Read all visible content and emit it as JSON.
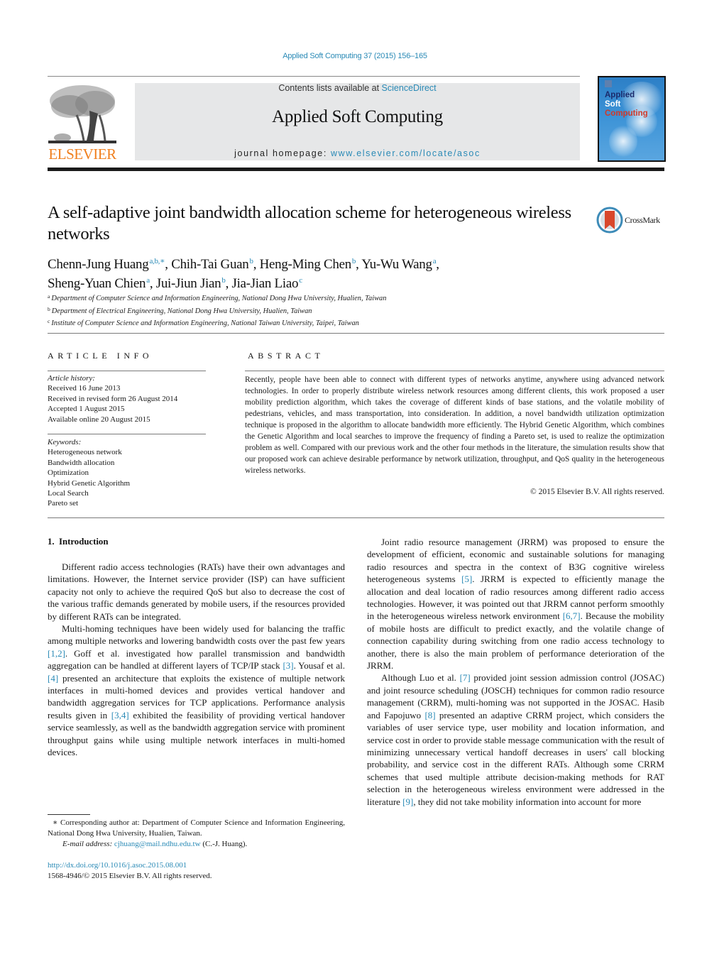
{
  "header": {
    "journal_ref": "Applied Soft Computing 37 (2015) 156–165",
    "contents_prefix": "Contents lists available at ",
    "contents_link": "ScienceDirect",
    "journal_title": "Applied Soft Computing",
    "homepage_prefix": "journal homepage: ",
    "homepage_link": "www.elsevier.com/locate/asoc",
    "publisher_logo": "ELSEVIER",
    "cover": {
      "line1": "Applied",
      "line2": "Soft",
      "line3": "Computing"
    },
    "colors": {
      "link": "#2a8ab6",
      "elsevier_orange": "#f07f1d",
      "masthead_bg": "#e6e7e8"
    }
  },
  "article": {
    "title": "A self-adaptive joint bandwidth allocation scheme for heterogeneous wireless networks",
    "crossmark_label": "CrossMark",
    "authors": [
      {
        "name": "Chenn-Jung Huang",
        "sup": "a,b,∗",
        "sep": ", "
      },
      {
        "name": "Chih-Tai Guan",
        "sup": "b",
        "sep": ", "
      },
      {
        "name": "Heng-Ming Chen",
        "sup": "b",
        "sep": ", "
      },
      {
        "name": "Yu-Wu Wang",
        "sup": "a",
        "sep": ","
      },
      {
        "name": "Sheng-Yuan Chien",
        "sup": "a",
        "sep": ", "
      },
      {
        "name": "Jui-Jiun Jian",
        "sup": "b",
        "sep": ", "
      },
      {
        "name": "Jia-Jian Liao",
        "sup": "c",
        "sep": ""
      }
    ],
    "affiliations": [
      {
        "key": "a",
        "text": "Department of Computer Science and Information Engineering, National Dong Hwa University, Hualien, Taiwan"
      },
      {
        "key": "b",
        "text": "Department of Electrical Engineering, National Dong Hwa University, Hualien, Taiwan"
      },
      {
        "key": "c",
        "text": "Institute of Computer Science and Information Engineering, National Taiwan University, Taipei, Taiwan"
      }
    ]
  },
  "article_info": {
    "heading": "ARTICLE INFO",
    "history_label": "Article history:",
    "history": [
      "Received 16 June 2013",
      "Received in revised form 26 August 2014",
      "Accepted 1 August 2015",
      "Available online 20 August 2015"
    ],
    "keywords_label": "Keywords:",
    "keywords": [
      "Heterogeneous network",
      "Bandwidth allocation",
      "Optimization",
      "Hybrid Genetic Algorithm",
      "Local Search",
      "Pareto set"
    ]
  },
  "abstract": {
    "heading": "ABSTRACT",
    "text": "Recently, people have been able to connect with different types of networks anytime, anywhere using advanced network technologies. In order to properly distribute wireless network resources among different clients, this work proposed a user mobility prediction algorithm, which takes the coverage of different kinds of base stations, and the volatile mobility of pedestrians, vehicles, and mass transportation, into consideration. In addition, a novel bandwidth utilization optimization technique is proposed in the algorithm to allocate bandwidth more efficiently. The Hybrid Genetic Algorithm, which combines the Genetic Algorithm and local searches to improve the frequency of finding a Pareto set, is used to realize the optimization problem as well. Compared with our previous work and the other four methods in the literature, the simulation results show that our proposed work can achieve desirable performance by network utilization, throughput, and QoS quality in the heterogeneous wireless networks.",
    "copyright": "© 2015 Elsevier B.V. All rights reserved."
  },
  "body": {
    "section_heading": "1.  Introduction",
    "left_paragraphs": [
      [
        {
          "t": "Different radio access technologies (RATs) have their own advantages and limitations. However, the Internet service provider (ISP) can have sufficient capacity not only to achieve the required QoS but also to decrease the cost of the various traffic demands generated by mobile users, if the resources provided by different RATs can be integrated."
        }
      ],
      [
        {
          "t": "Multi-homing techniques have been widely used for balancing the traffic among multiple networks and lowering bandwidth costs over the past few years "
        },
        {
          "ref": "[1,2]"
        },
        {
          "t": ". Goff et al. investigated how parallel transmission and bandwidth aggregation can be handled at different layers of TCP/IP stack "
        },
        {
          "ref": "[3]"
        },
        {
          "t": ". Yousaf et al. "
        },
        {
          "ref": "[4]"
        },
        {
          "t": " presented an architecture that exploits the existence of multiple network interfaces in multi-homed devices and provides vertical handover and bandwidth aggregation services for TCP applications. Performance analysis results given in "
        },
        {
          "ref": "[3,4]"
        },
        {
          "t": " exhibited the feasibility of providing vertical handover service seamlessly, as well as the bandwidth aggregation service with prominent throughput gains while using multiple network interfaces in multi-homed devices."
        }
      ]
    ],
    "right_paragraphs": [
      [
        {
          "t": "Joint radio resource management (JRRM) was proposed to ensure the development of efficient, economic and sustainable solutions for managing radio resources and spectra in the context of B3G cognitive wireless heterogeneous systems "
        },
        {
          "ref": "[5]"
        },
        {
          "t": ". JRRM is expected to efficiently manage the allocation and deal location of radio resources among different radio access technologies. However, it was pointed out that JRRM cannot perform smoothly in the heterogeneous wireless network environment "
        },
        {
          "ref": "[6,7]"
        },
        {
          "t": ". Because the mobility of mobile hosts are difficult to predict exactly, and the volatile change of connection capability during switching from one radio access technology to another, there is also the main problem of performance deterioration of the JRRM."
        }
      ],
      [
        {
          "t": "Although Luo et al. "
        },
        {
          "ref": "[7]"
        },
        {
          "t": " provided joint session admission control (JOSAC) and joint resource scheduling (JOSCH) techniques for common radio resource management (CRRM), multi-homing was not supported in the JOSAC. Hasib and Fapojuwo "
        },
        {
          "ref": "[8]"
        },
        {
          "t": " presented an adaptive CRRM project, which considers the variables of user service type, user mobility and location information, and service cost in order to provide stable message communication with the result of minimizing unnecessary vertical handoff decreases in users' call blocking probability, and service cost in the different RATs. Although some CRRM schemes that used multiple attribute decision-making methods for RAT selection in the heterogeneous wireless environment were addressed in the literature "
        },
        {
          "ref": "[9]"
        },
        {
          "t": ", they did not take mobility information into account for more"
        }
      ]
    ]
  },
  "footnote": {
    "corresponding": "∗ Corresponding author at: Department of Computer Science and Information Engineering, National Dong Hwa University, Hualien, Taiwan.",
    "email_label": "E-mail address: ",
    "email": "cjhuang@mail.ndhu.edu.tw",
    "email_suffix": " (C.-J. Huang).",
    "doi": "http://dx.doi.org/10.1016/j.asoc.2015.08.001",
    "issn_line": "1568-4946/© 2015 Elsevier B.V. All rights reserved."
  }
}
